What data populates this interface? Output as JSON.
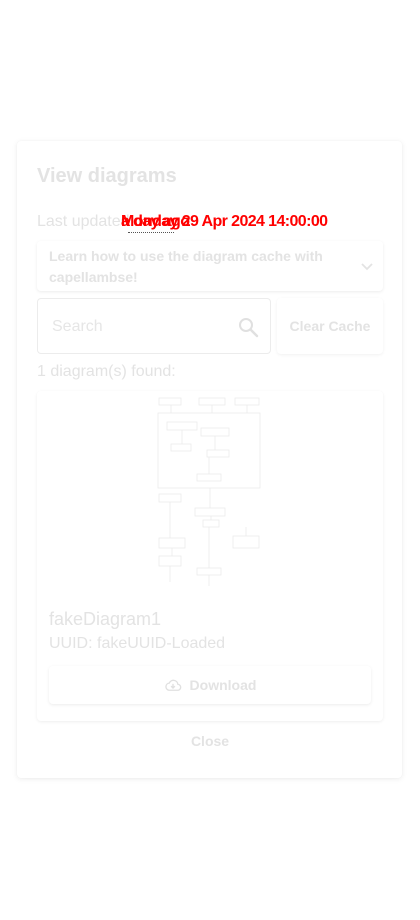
{
  "dialog": {
    "title": "View diagrams",
    "last_updated_label": "Last updated:",
    "timestamp_overlap_a": "Monday 29 Apr 2024 14:00:00",
    "timestamp_overlap_b": "a day ago",
    "help_label": "Learn how to use the diagram cache with capellambse!",
    "search_placeholder": "Search",
    "clear_cache_label": "Clear Cache",
    "found_label": "1 diagram(s) found:",
    "close_label": "Close"
  },
  "diagrams": [
    {
      "name": "fakeDiagram1",
      "uuid_label": "UUID: fakeUUID-Loaded",
      "download_label": "Download"
    }
  ],
  "icons": {
    "search": "search-icon",
    "chevron": "chevron-down-icon",
    "download": "cloud-download-icon"
  },
  "colors": {
    "faded_text": "#e3e3e3",
    "timestamp_overlay": "#ff0000"
  }
}
